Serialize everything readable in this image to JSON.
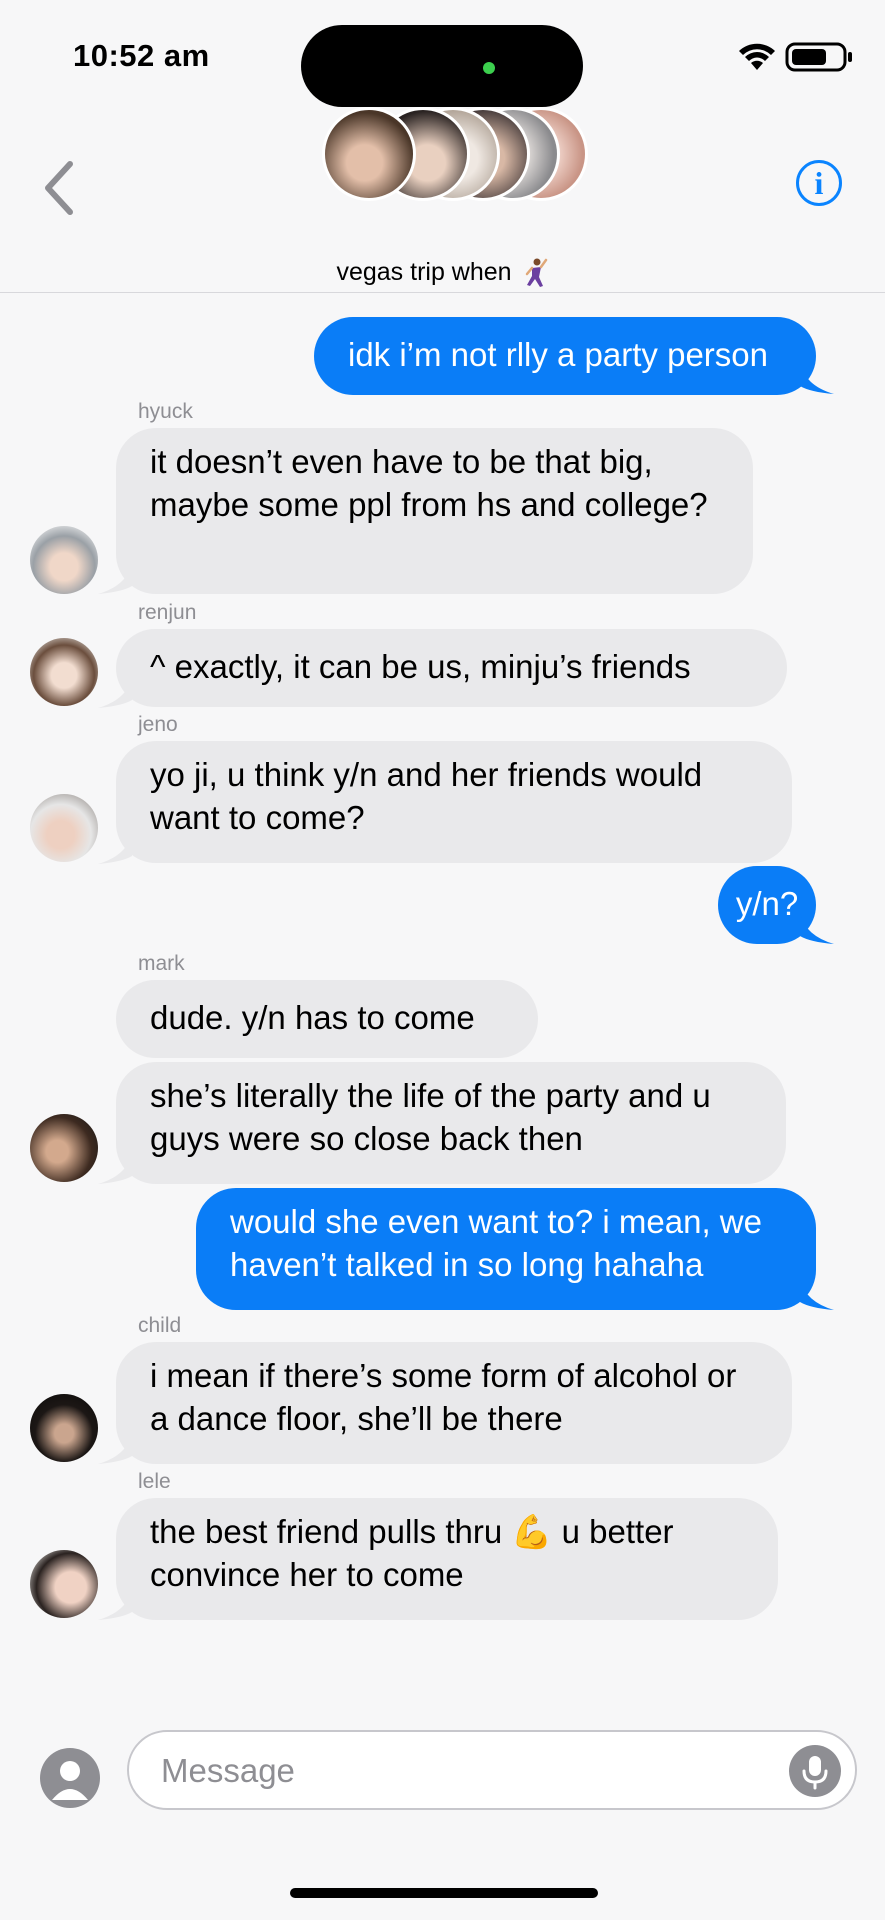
{
  "status_bar": {
    "time": "10:52 am"
  },
  "header": {
    "group_name": "vegas trip when",
    "group_emoji": "dancer-emoji",
    "back_icon": "chevron-left-icon",
    "info_icon": "info-icon",
    "info_glyph": "i",
    "participant_avatars": 6
  },
  "messages": [
    {
      "sender": "",
      "direction": "outgoing",
      "text": "idk i’m not rlly a party person"
    },
    {
      "sender": "hyuck",
      "direction": "incoming",
      "text": "it doesn’t even have to be that big, maybe some ppl from hs and college?"
    },
    {
      "sender": "renjun",
      "direction": "incoming",
      "text": "^ exactly, it can be us, minju’s friends"
    },
    {
      "sender": "jeno",
      "direction": "incoming",
      "text": "yo ji, u think y/n and her friends would want to come?"
    },
    {
      "sender": "",
      "direction": "outgoing",
      "text": "y/n?"
    },
    {
      "sender": "mark",
      "direction": "incoming",
      "text": "dude. y/n has to come"
    },
    {
      "sender": "",
      "direction": "incoming",
      "text": "she’s literally the life of the party and u guys were so close back then"
    },
    {
      "sender": "",
      "direction": "outgoing",
      "text": "would she even want to? i mean, we haven’t talked in so long hahaha"
    },
    {
      "sender": "child",
      "direction": "incoming",
      "text": "i mean if there’s some form of alcohol or a dance floor, she’ll be there"
    },
    {
      "sender": "lele",
      "direction": "incoming",
      "text": "the best friend pulls thru 💪 u better convince her to come"
    }
  ],
  "composer": {
    "placeholder": "Message",
    "apps_icon": "apps-icon",
    "mic_icon": "microphone-icon"
  },
  "colors": {
    "outgoing_bubble": "#0a7df7",
    "incoming_bubble": "#e9e9eb",
    "accent": "#0a84ff",
    "sender_label": "#8e8e93"
  }
}
